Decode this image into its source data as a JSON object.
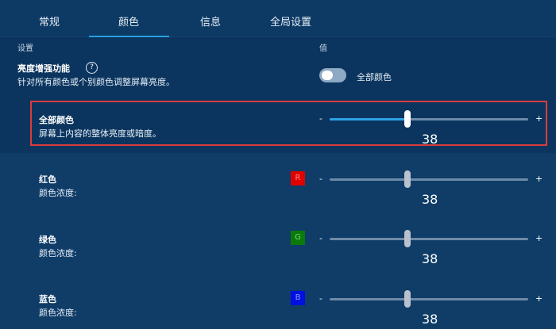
{
  "tabs": [
    {
      "label": "常规"
    },
    {
      "label": "颜色"
    },
    {
      "label": "信息"
    },
    {
      "label": "全局设置"
    }
  ],
  "columns": {
    "setting": "设置",
    "value": "值"
  },
  "brightness": {
    "title": "亮度增强功能",
    "help_icon": "question-circle-icon",
    "description": "针对所有颜色或个别颜色调整屏幕亮度。",
    "toggle_label": "全部颜色",
    "toggle_on": false
  },
  "all_colors": {
    "title": "全部颜色",
    "description": "屏幕上内容的整体亮度或暗度。",
    "minus": "-",
    "plus": "+",
    "value": "38",
    "level": 0.38,
    "enabled": true
  },
  "channels": [
    {
      "title": "红色",
      "description": "颜色浓度:",
      "swatch_label": "R",
      "swatch_color": "#e00000",
      "swatch_text": "#ff8a8a",
      "minus": "-",
      "plus": "+",
      "value": "38",
      "level": 0.38
    },
    {
      "title": "绿色",
      "description": "颜色浓度:",
      "swatch_label": "G",
      "swatch_color": "#0b7a0b",
      "swatch_text": "#6fd86f",
      "minus": "-",
      "plus": "+",
      "value": "38",
      "level": 0.38
    },
    {
      "title": "蓝色",
      "description": "颜色浓度:",
      "swatch_label": "B",
      "swatch_color": "#0010e0",
      "swatch_text": "#8f9dff",
      "minus": "-",
      "plus": "+",
      "value": "38",
      "level": 0.38
    }
  ],
  "colors": {
    "accent": "#2ba2e6",
    "highlight_border": "#dc3b3b",
    "background": "#0f3d68"
  }
}
